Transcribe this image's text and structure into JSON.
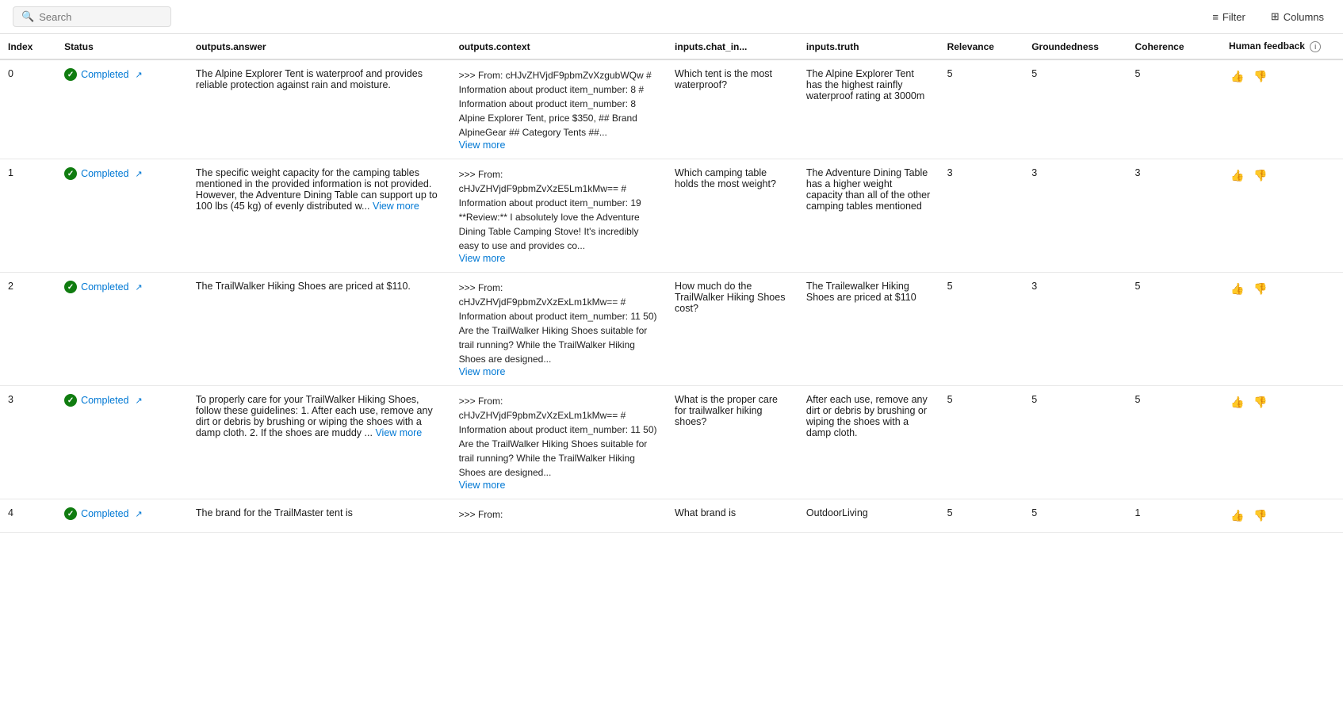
{
  "topbar": {
    "search_placeholder": "Search",
    "filter_label": "Filter",
    "columns_label": "Columns"
  },
  "table": {
    "columns": [
      {
        "key": "index",
        "label": "Index"
      },
      {
        "key": "status",
        "label": "Status"
      },
      {
        "key": "answer",
        "label": "outputs.answer"
      },
      {
        "key": "context",
        "label": "outputs.context"
      },
      {
        "key": "chat_in",
        "label": "inputs.chat_in..."
      },
      {
        "key": "truth",
        "label": "inputs.truth"
      },
      {
        "key": "relevance",
        "label": "Relevance"
      },
      {
        "key": "groundedness",
        "label": "Groundedness"
      },
      {
        "key": "coherence",
        "label": "Coherence"
      },
      {
        "key": "human_feedback",
        "label": "Human feedback"
      }
    ],
    "rows": [
      {
        "index": "0",
        "status": "Completed",
        "answer": "The Alpine Explorer Tent is waterproof and provides reliable protection against rain and moisture.",
        "answer_full": true,
        "context": ">>> From: cHJvZHVjdF9pbmZvXzgubWQw # Information about product item_number: 8 # Information about product item_number: 8 Alpine Explorer Tent, price $350, ## Brand AlpineGear ## Category Tents ##...",
        "context_truncated": true,
        "chat_in": "Which tent is the most waterproof?",
        "truth": "The Alpine Explorer Tent has the highest rainfly waterproof rating at 3000m",
        "relevance": "5",
        "groundedness": "5",
        "coherence": "5"
      },
      {
        "index": "1",
        "status": "Completed",
        "answer": "The specific weight capacity for the camping tables mentioned in the provided information is not provided. However, the Adventure Dining Table can support up to 100 lbs (45 kg) of evenly distributed w...",
        "answer_truncated": true,
        "answer_view_more": "View more",
        "context": ">>> From: cHJvZHVjdF9pbmZvXzE5Lm1kMw== # Information about product item_number: 19 **Review:** I absolutely love the Adventure Dining Table Camping Stove! It's incredibly easy to use and provides co...",
        "context_truncated": true,
        "chat_in": "Which camping table holds the most weight?",
        "truth": "The Adventure Dining Table has a higher weight capacity than all of the other camping tables mentioned",
        "relevance": "3",
        "groundedness": "3",
        "coherence": "3"
      },
      {
        "index": "2",
        "status": "Completed",
        "answer": "The TrailWalker Hiking Shoes are priced at $110.",
        "answer_full": true,
        "context": ">>> From: cHJvZHVjdF9pbmZvXzExLm1kMw== # Information about product item_number: 11 50) Are the TrailWalker Hiking Shoes suitable for trail running? While the TrailWalker Hiking Shoes are designed...",
        "context_truncated": true,
        "chat_in": "How much do the TrailWalker Hiking Shoes cost?",
        "truth": "The Trailewalker Hiking Shoes are priced at $110",
        "relevance": "5",
        "groundedness": "3",
        "coherence": "5"
      },
      {
        "index": "3",
        "status": "Completed",
        "answer": "To properly care for your TrailWalker Hiking Shoes, follow these guidelines: 1. After each use, remove any dirt or debris by brushing or wiping the shoes with a damp cloth. 2. If the shoes are muddy ...",
        "answer_truncated": true,
        "answer_view_more": "View more",
        "context": ">>> From: cHJvZHVjdF9pbmZvXzExLm1kMw== # Information about product item_number: 11 50) Are the TrailWalker Hiking Shoes suitable for trail running? While the TrailWalker Hiking Shoes are designed...",
        "context_truncated": true,
        "chat_in": "What is the proper care for trailwalker hiking shoes?",
        "truth": "After each use, remove any dirt or debris by brushing or wiping the shoes with a damp cloth.",
        "relevance": "5",
        "groundedness": "5",
        "coherence": "5"
      },
      {
        "index": "4",
        "status": "Completed",
        "answer": "The brand for the TrailMaster tent is",
        "answer_truncated": false,
        "context": ">>> From:",
        "context_truncated": false,
        "chat_in": "What brand is",
        "truth": "OutdoorLiving",
        "relevance": "5",
        "groundedness": "5",
        "coherence": "1"
      }
    ]
  }
}
